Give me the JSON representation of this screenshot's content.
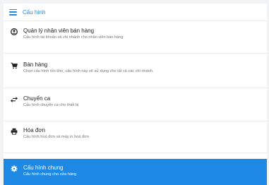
{
  "header": {
    "title": "Cấu hình",
    "icon": "menu-icon"
  },
  "items": [
    {
      "title": "Quản lý nhân viên bán hàng",
      "desc": "Cấu hình tài khoản và chi nhánh cho nhân viên bán hàng",
      "icon": "user-circle-icon"
    },
    {
      "title": "Bán hàng",
      "desc": "Chọn cấu hình tồn kho, cấu hình này sẽ sử dụng cho tất cả các chi nhánh.",
      "icon": "cart-icon"
    },
    {
      "title": "Chuyển ca",
      "desc": "Cấu hình chuyển ca cho thiết bị",
      "icon": "swap-arrows-icon"
    },
    {
      "title": "Hóa đơn",
      "desc": "Cấu hình hoá đơn và máy in hoá đơn",
      "icon": "printer-icon"
    },
    {
      "title": "Cấu hình chung",
      "desc": "Cấu hình chung cho cửa hàng",
      "icon": "gear-icon",
      "active": true
    }
  ],
  "colors": {
    "accent": "#1e88e5"
  }
}
